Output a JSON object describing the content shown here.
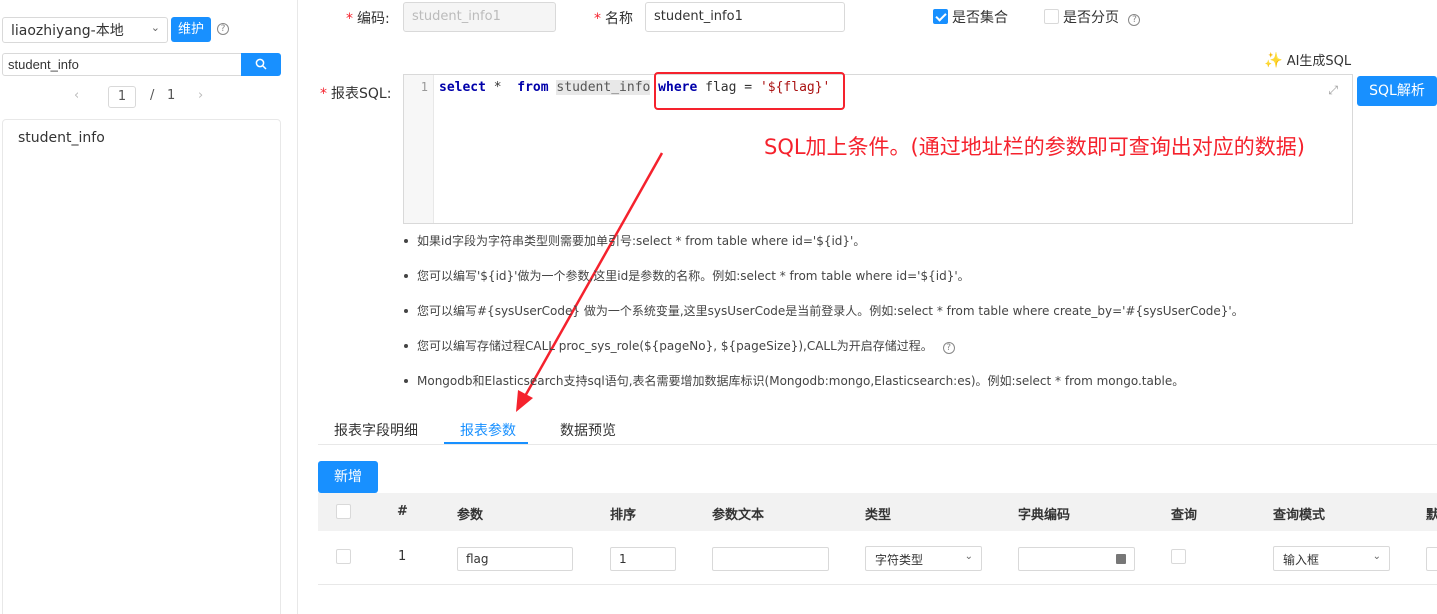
{
  "sidebar": {
    "datasource": "liaozhiyang-本地",
    "maintain_label": "维护",
    "search_value": "student_info",
    "pager": {
      "current": "1",
      "separator": "/",
      "total": "1"
    },
    "tables": [
      "student_info"
    ]
  },
  "form": {
    "code_label": "编码:",
    "code_value": "student_info1",
    "name_label": "名称",
    "name_value": "student_info1",
    "is_collection_label": "是否集合",
    "is_collection_checked": true,
    "is_paging_label": "是否分页",
    "is_paging_checked": false,
    "ai_sql_label": "AI生成SQL",
    "sql_label": "报表SQL:",
    "sql_line_number": "1",
    "sql_parts": {
      "kw1": "select",
      "star": " *  ",
      "kw2": "from",
      "table": "student_info",
      "kw3": "where",
      "cond": " flag = ",
      "str": "'${flag}'"
    },
    "parse_button": "SQL解析"
  },
  "annotation": "SQL加上条件。(通过地址栏的参数即可查询出对应的数据)",
  "tips": [
    "如果id字段为字符串类型则需要加单引号:select * from table where id='${id}'。",
    "您可以编写'${id}'做为一个参数,这里id是参数的名称。例如:select * from table where id='${id}'。",
    "您可以编写#{sysUserCode} 做为一个系统变量,这里sysUserCode是当前登录人。例如:select * from table where create_by='#{sysUserCode}'。",
    "您可以编写存储过程CALL proc_sys_role(${pageNo}, ${pageSize}),CALL为开启存储过程。",
    "Mongodb和Elasticsearch支持sql语句,表名需要增加数据库标识(Mongodb:mongo,Elasticsearch:es)。例如:select * from mongo.table。"
  ],
  "tabs": [
    "报表字段明细",
    "报表参数",
    "数据预览"
  ],
  "active_tab": "报表参数",
  "add_button": "新增",
  "param_table": {
    "headers": [
      "#",
      "参数",
      "排序",
      "参数文本",
      "类型",
      "字典编码",
      "查询",
      "查询模式",
      "默"
    ],
    "rows": [
      {
        "index": "1",
        "param": "flag",
        "order": "1",
        "text": "",
        "type": "字符类型",
        "dict": "",
        "query": false,
        "mode": "输入框"
      }
    ]
  },
  "colors": {
    "primary": "#1890ff",
    "danger": "#f5222d"
  }
}
